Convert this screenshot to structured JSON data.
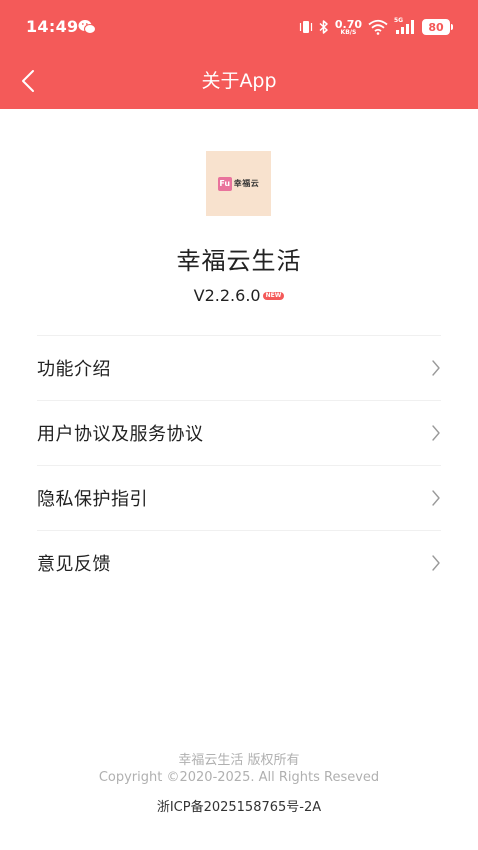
{
  "status_bar": {
    "time": "14:49",
    "net_speed_value": "0.70",
    "net_speed_unit": "KB/S",
    "network_type": "5G",
    "battery": "80"
  },
  "header": {
    "title": "关于App"
  },
  "app": {
    "logo_mark": "Fu",
    "logo_text": "幸福云",
    "name": "幸福云生活",
    "version": "V2.2.6.0",
    "new_badge": "NEW"
  },
  "menu": {
    "items": [
      {
        "label": "功能介绍"
      },
      {
        "label": "用户协议及服务协议"
      },
      {
        "label": "隐私保护指引"
      },
      {
        "label": "意见反馈"
      }
    ]
  },
  "footer": {
    "copyright_line1": "幸福云生活 版权所有",
    "copyright_line2": "Copyright ©2020-2025. All Rights Reseved",
    "icp": "浙ICP备2025158765号-2A"
  },
  "colors": {
    "header_bg": "#F45A59",
    "logo_bg": "#F8E2CE",
    "logo_mark": "#E9739C"
  }
}
